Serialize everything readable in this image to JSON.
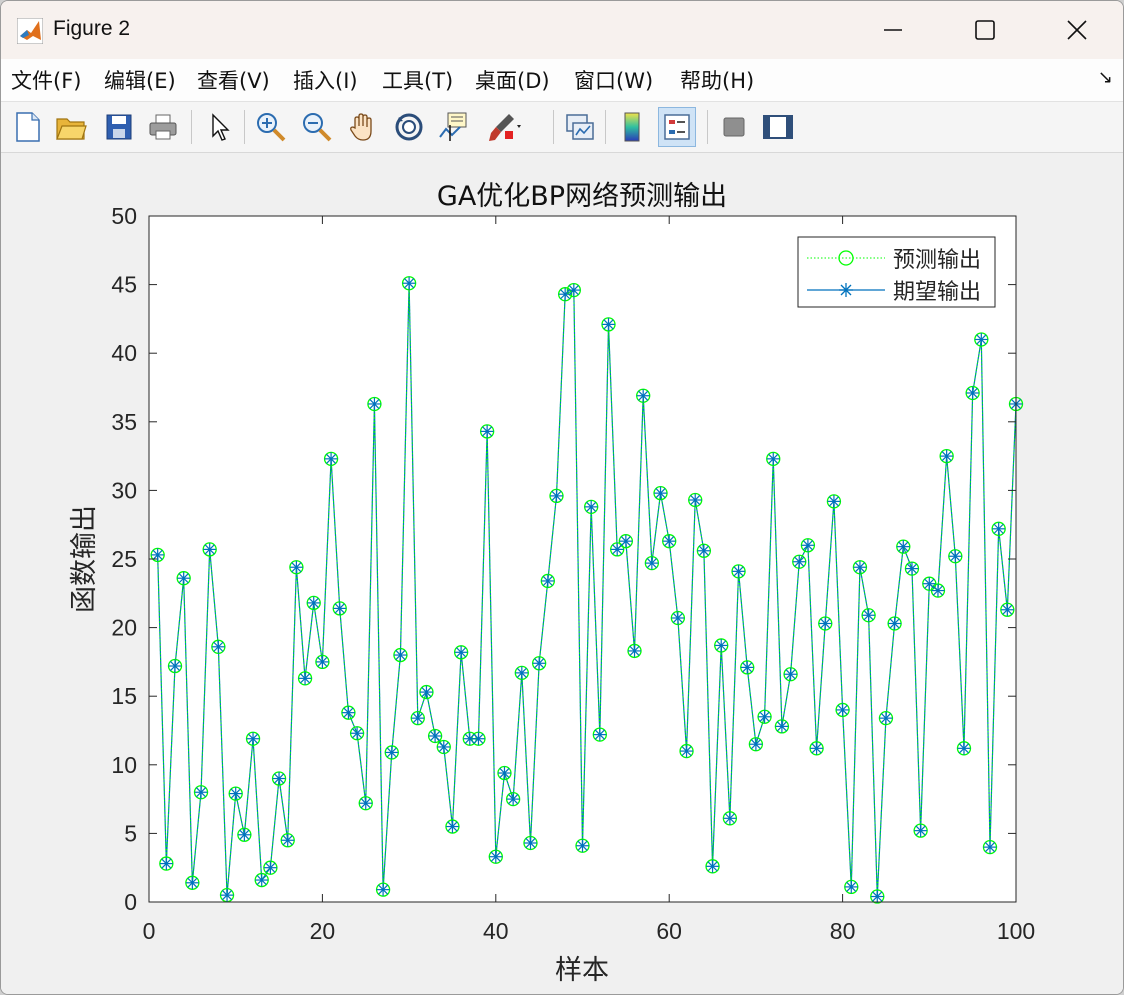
{
  "window": {
    "title": "Figure 2",
    "controls": {
      "minimize": "—",
      "maximize": "☐",
      "close": "✕"
    }
  },
  "menu": [
    {
      "label": "文件(F)"
    },
    {
      "label": "编辑(E)"
    },
    {
      "label": "查看(V)"
    },
    {
      "label": "插入(I)"
    },
    {
      "label": "工具(T)"
    },
    {
      "label": "桌面(D)"
    },
    {
      "label": "窗口(W)"
    },
    {
      "label": "帮助(H)"
    }
  ],
  "menu_overflow_icon": "↘",
  "toolbar": [
    {
      "icon": "new-figure-icon"
    },
    {
      "icon": "open-folder-icon"
    },
    {
      "icon": "save-icon"
    },
    {
      "icon": "print-icon"
    },
    {
      "icon": "pointer-icon"
    },
    {
      "icon": "zoom-in-icon"
    },
    {
      "icon": "zoom-out-icon"
    },
    {
      "icon": "pan-hand-icon"
    },
    {
      "icon": "rotate-3d-icon"
    },
    {
      "icon": "data-cursor-icon"
    },
    {
      "icon": "brush-icon"
    },
    {
      "icon": "link-plot-icon"
    },
    {
      "icon": "colorbar-icon"
    },
    {
      "icon": "legend-icon",
      "active": true
    },
    {
      "icon": "hide-plot-tools-icon"
    },
    {
      "icon": "show-plot-tools-icon"
    }
  ],
  "chart_data": {
    "type": "line",
    "title": "GA优化BP网络预测输出",
    "xlabel": "样本",
    "ylabel": "函数输出",
    "xlim": [
      0,
      100
    ],
    "ylim": [
      0,
      50
    ],
    "xticks": [
      0,
      20,
      40,
      60,
      80,
      100
    ],
    "yticks": [
      0,
      5,
      10,
      15,
      20,
      25,
      30,
      35,
      40,
      45,
      50
    ],
    "grid": false,
    "legend_position": "top-right",
    "x": [
      1,
      2,
      3,
      4,
      5,
      6,
      7,
      8,
      9,
      10,
      11,
      12,
      13,
      14,
      15,
      16,
      17,
      18,
      19,
      20,
      21,
      22,
      23,
      24,
      25,
      26,
      27,
      28,
      29,
      30,
      31,
      32,
      33,
      34,
      35,
      36,
      37,
      38,
      39,
      40,
      41,
      42,
      43,
      44,
      45,
      46,
      47,
      48,
      49,
      50,
      51,
      52,
      53,
      54,
      55,
      56,
      57,
      58,
      59,
      60,
      61,
      62,
      63,
      64,
      65,
      66,
      67,
      68,
      69,
      70,
      71,
      72,
      73,
      74,
      75,
      76,
      77,
      78,
      79,
      80,
      81,
      82,
      83,
      84,
      85,
      86,
      87,
      88,
      89,
      90,
      91,
      92,
      93,
      94,
      95,
      96,
      97,
      98,
      99,
      100
    ],
    "series": [
      {
        "name": "预测输出",
        "color": "#00ff00",
        "marker": "circle",
        "line": "dotted",
        "values": [
          25.3,
          2.8,
          17.2,
          23.6,
          1.4,
          8.0,
          25.7,
          18.6,
          0.5,
          7.9,
          4.9,
          11.9,
          1.6,
          2.5,
          9.0,
          4.5,
          24.4,
          16.3,
          21.8,
          17.5,
          32.3,
          21.4,
          13.8,
          12.3,
          7.2,
          36.3,
          0.9,
          10.9,
          18.0,
          45.1,
          13.4,
          15.3,
          12.1,
          11.3,
          5.5,
          18.2,
          11.9,
          11.9,
          34.3,
          3.3,
          9.4,
          7.5,
          16.7,
          4.3,
          17.4,
          23.4,
          29.6,
          44.3,
          44.6,
          4.1,
          28.8,
          12.2,
          42.1,
          25.7,
          26.3,
          18.3,
          36.9,
          24.7,
          29.8,
          26.3,
          20.7,
          11.0,
          29.3,
          25.6,
          2.6,
          18.7,
          6.1,
          24.1,
          17.1,
          11.5,
          13.5,
          32.3,
          12.8,
          16.6,
          24.8,
          26.0,
          11.2,
          20.3,
          29.2,
          14.0,
          1.1,
          24.4,
          20.9,
          0.4,
          13.4,
          20.3,
          25.9,
          24.3,
          5.2,
          23.2,
          22.7,
          32.5,
          25.2,
          11.2,
          37.1,
          41.0,
          4.0,
          27.2,
          21.3,
          36.3
        ]
      },
      {
        "name": "期望输出",
        "color": "#0072bd",
        "marker": "asterisk",
        "line": "solid",
        "values": [
          25.3,
          2.8,
          17.2,
          23.6,
          1.4,
          8.0,
          25.7,
          18.6,
          0.5,
          7.9,
          4.9,
          11.9,
          1.6,
          2.5,
          9.0,
          4.5,
          24.4,
          16.3,
          21.8,
          17.5,
          32.3,
          21.4,
          13.8,
          12.3,
          7.2,
          36.3,
          0.9,
          10.9,
          18.0,
          45.1,
          13.4,
          15.3,
          12.1,
          11.3,
          5.5,
          18.2,
          11.9,
          11.9,
          34.3,
          3.3,
          9.4,
          7.5,
          16.7,
          4.3,
          17.4,
          23.4,
          29.6,
          44.3,
          44.6,
          4.1,
          28.8,
          12.2,
          42.1,
          25.7,
          26.3,
          18.3,
          36.9,
          24.7,
          29.8,
          26.3,
          20.7,
          11.0,
          29.3,
          25.6,
          2.6,
          18.7,
          6.1,
          24.1,
          17.1,
          11.5,
          13.5,
          32.3,
          12.8,
          16.6,
          24.8,
          26.0,
          11.2,
          20.3,
          29.2,
          14.0,
          1.1,
          24.4,
          20.9,
          0.4,
          13.4,
          20.3,
          25.9,
          24.3,
          5.2,
          23.2,
          22.7,
          32.5,
          25.2,
          11.2,
          37.1,
          41.0,
          4.0,
          27.2,
          21.3,
          36.3
        ]
      }
    ]
  }
}
